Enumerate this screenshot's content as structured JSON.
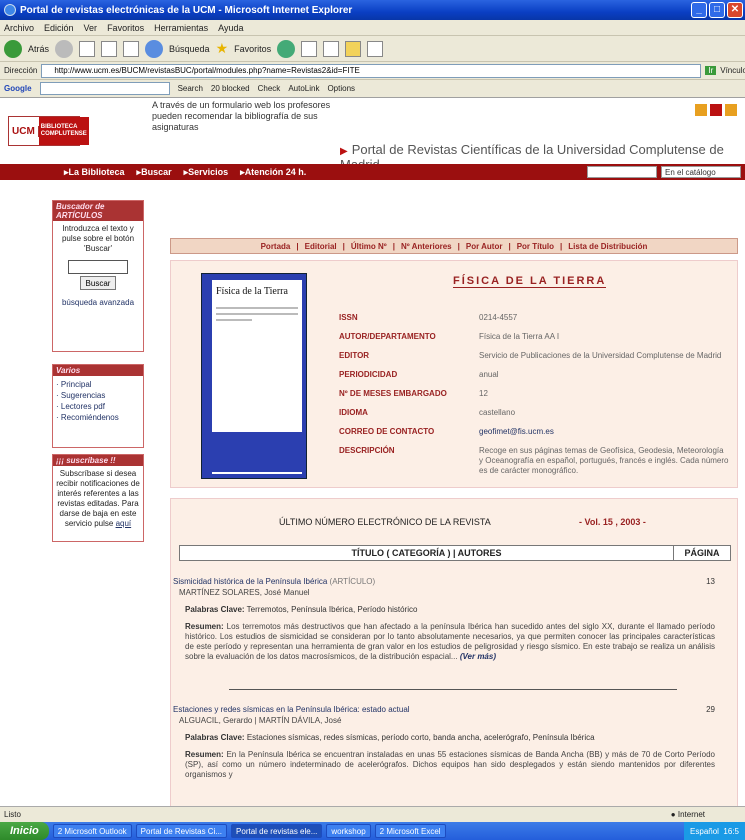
{
  "window": {
    "title": "Portal de revistas electrónicas de la UCM - Microsoft Internet Explorer",
    "btn_min": "_",
    "btn_max": "□",
    "btn_close": "✕"
  },
  "menubar": [
    "Archivo",
    "Edición",
    "Ver",
    "Favoritos",
    "Herramientas",
    "Ayuda"
  ],
  "toolbar": {
    "back": "Atrás",
    "search": "Búsqueda",
    "favorites": "Favoritos"
  },
  "addressbar": {
    "label": "Dirección",
    "url": "http://www.ucm.es/BUCM/revistasBUC/portal/modules.php?name=Revistas2&id=FITE",
    "go": "Ir",
    "links": "Vínculos"
  },
  "googlebar": {
    "brand": "Google",
    "search": "Search",
    "blocked": "20 blocked",
    "check": "Check",
    "autolink": "AutoLink",
    "options": "Options"
  },
  "header": {
    "logo_ucm": "UCM",
    "logo_bib": "BIBLIOTECA COMPLUTENSE",
    "tagline": "A través de un formulario web los profesores pueden recomendar la bibliografía de sus asignaturas",
    "portal_title": "Portal de Revistas Científicas de la Universidad Complutense de Madrid",
    "nav": [
      "La Biblioteca",
      "Buscar",
      "Servicios",
      "Atención 24 h."
    ],
    "select": "En el catálogo"
  },
  "sidebar": {
    "search_head": "Buscador de ARTÍCULOS",
    "search_text": "Introduzca el texto y pulse sobre el botón 'Buscar'",
    "search_btn": "Buscar",
    "advanced": "búsqueda avanzada",
    "varios_head": "Varios",
    "varios": [
      "Principal",
      "Sugerencias",
      "Lectores pdf",
      "Recomiéndenos"
    ],
    "subs_head": "¡¡¡ suscríbase !!",
    "subs_text": "Subscríbase si desea recibir notificaciones de interés referentes a las revistas editadas. Para darse de baja en este servicio pulse",
    "subs_link": "aquí"
  },
  "tabs": [
    "Portada",
    "Editorial",
    "Último Nº",
    "Nº Anteriores",
    "Por Autor",
    "Por Título",
    "Lista de Distribución"
  ],
  "journal": {
    "cover_title": "Física de la Tierra",
    "title": "FÍSICA DE LA TIERRA",
    "fields": [
      {
        "k": "ISSN",
        "v": "0214-4557"
      },
      {
        "k": "AUTOR/DEPARTAMENTO",
        "v": "Física de la Tierra AA I"
      },
      {
        "k": "EDITOR",
        "v": "Servicio de Publicaciones de la Universidad Complutense de Madrid"
      },
      {
        "k": "PERIODICIDAD",
        "v": "anual"
      },
      {
        "k": "Nº DE MESES EMBARGADO",
        "v": "12"
      },
      {
        "k": "IDIOMA",
        "v": "castellano"
      },
      {
        "k": "CORREO DE CONTACTO",
        "v": "geofimet@fis.ucm.es"
      },
      {
        "k": "DESCRIPCIÓN",
        "v": "Recoge en sus páginas temas de Geofísica, Geodesia, Meteorología y Oceanografía en español, portugués, francés e inglés. Cada número es de carácter monográfico."
      }
    ]
  },
  "last_issue": {
    "heading": "ÚLTIMO NÚMERO ELECTRÓNICO DE LA REVISTA",
    "volume": "- Vol. 15 , 2003 -",
    "col_title": "TÍTULO ( CATEGORÍA ) | AUTORES",
    "col_page": "PÁGINA",
    "articles": [
      {
        "title": "Sismicidad histórica de la Península Ibérica",
        "category": "(ARTÍCULO)",
        "page": "13",
        "authors": "MARTÍNEZ SOLARES, José Manuel",
        "kw_label": "Palabras Clave:",
        "keywords": "Terremotos, Península Ibérica, Período histórico",
        "res_label": "Resumen:",
        "summary": "Los terremotos más destructivos que han afectado a la península Ibérica han sucedido antes del siglo XX, durante el llamado período histórico. Los estudios de sismicidad se consideran por lo tanto absolutamente necesarios, ya que permiten conocer las principales características de este período y representan una herramienta de gran valor en los estudios de peligrosidad y riesgo sísmico. En este trabajo se realiza un análisis sobre la evaluación de los datos macrosísmicos, de la distribución espacial...",
        "more": "(Ver más)"
      },
      {
        "title": "Estaciones y redes sísmicas en la Península Ibérica: estado actual",
        "category": "",
        "page": "29",
        "authors": "ALGUACIL, Gerardo | MARTÍN DÁVILA, José",
        "kw_label": "Palabras Clave:",
        "keywords": "Estaciones sísmicas, redes sísmicas, período corto, banda ancha, acelerógrafo, Península Ibérica",
        "res_label": "Resumen:",
        "summary": "En la Península Ibérica se encuentran instaladas en unas 55 estaciones sísmicas de Banda Ancha (BB) y más de 70 de Corto Período (SP), así como un número indeterminado de acelerógrafos. Dichos equipos han sido desplegados y están siendo mantenidos por diferentes organismos y",
        "more": ""
      }
    ]
  },
  "status": {
    "left": "Listo",
    "right": "Internet"
  },
  "taskbar": {
    "start": "Inicio",
    "items": [
      "2 Microsoft Outlook",
      "Portal de Revistas Ci...",
      "Portal de revistas ele...",
      "workshop",
      "2 Microsoft Excel"
    ],
    "tray_text": "Español",
    "clock": "16:5"
  }
}
